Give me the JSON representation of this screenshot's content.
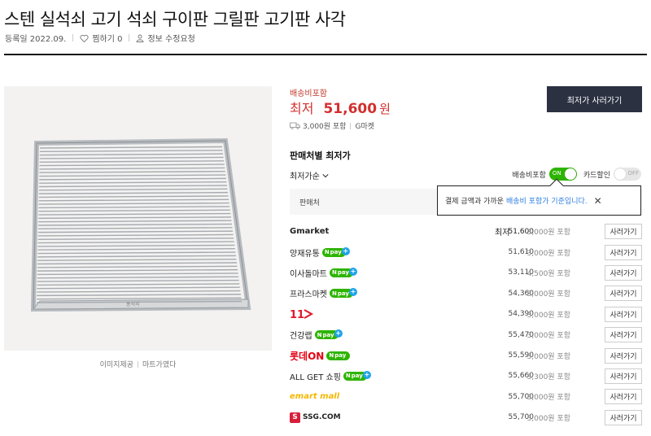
{
  "header": {
    "title": "스텐 실석쇠 고기 석쇠 구이판 그릴판 고기판 사각",
    "registered": "등록일 2022.09.",
    "wishlist": "찜하기 0",
    "report": "정보 수정요청"
  },
  "image": {
    "stamp": "홍석쇠",
    "caption_left": "이미지제공",
    "caption_right": "마트가였다"
  },
  "summary": {
    "shipping_included": "배송비포함",
    "lowest_label": "최저",
    "lowest_price": "51,600",
    "currency": "원",
    "shipping_fee": "3,000원 포함",
    "seller": "G마켓",
    "buy_button": "최저가 사러가기"
  },
  "sellers_section": {
    "title": "판매처별 최저가",
    "sort_label": "최저가순",
    "toggle_ship_label": "배송비포함",
    "toggle_ship_state": "ON",
    "toggle_card_label": "카드할인",
    "toggle_card_state": "OFF",
    "column_seller": "판매처",
    "tooltip_text": "결제 금액과 가까운",
    "tooltip_highlight": "배송비 포함가 기준입니다.",
    "tooltip_close": "✕"
  },
  "npay_label": "pay",
  "rows": [
    {
      "shop": "Gmarket",
      "logo": "gmarket",
      "npay": false,
      "lowest": "최저",
      "price": "51,600",
      "ship": "3,000원 포함",
      "button": "사러가기"
    },
    {
      "shop": "양재유통",
      "logo": "text",
      "npay": true,
      "price": "51,610",
      "ship": "3,000원 포함",
      "button": "사러가기"
    },
    {
      "shop": "이사돌마트",
      "logo": "text",
      "npay": true,
      "price": "53,110",
      "ship": "4,500원 포함",
      "button": "사러가기"
    },
    {
      "shop": "프라스마켓",
      "logo": "text",
      "npay": true,
      "price": "54,360",
      "ship": "3,000원 포함",
      "button": "사러가기"
    },
    {
      "shop": "11번가",
      "logo": "11st",
      "npay": false,
      "price": "54,390",
      "ship": "3,000원 포함",
      "button": "사러가기"
    },
    {
      "shop": "건강랩",
      "logo": "text",
      "npay": true,
      "price": "55,470",
      "ship": "3,000원 포함",
      "button": "사러가기"
    },
    {
      "shop": "롯데ON",
      "logo": "lotteon",
      "npay": true,
      "price": "55,590",
      "ship": "3,000원 포함",
      "button": "사러가기"
    },
    {
      "shop": "ALL GET 쇼핑",
      "logo": "text",
      "npay": true,
      "price": "55,660",
      "ship": "3,300원 포함",
      "button": "사러가기"
    },
    {
      "shop": "emart mall",
      "logo": "emart",
      "npay": false,
      "price": "55,700",
      "ship": "3,000원 포함",
      "button": "사러가기"
    },
    {
      "shop": "SSG.COM",
      "logo": "ssg",
      "npay": false,
      "price": "55,700",
      "ship": "3,000원 포함",
      "button": "사러가기"
    }
  ],
  "colors": {
    "accent_red": "#d32f2f",
    "npay_green": "#2db400",
    "button_dark": "#2b3141",
    "tooltip_blue": "#2e7de1"
  }
}
